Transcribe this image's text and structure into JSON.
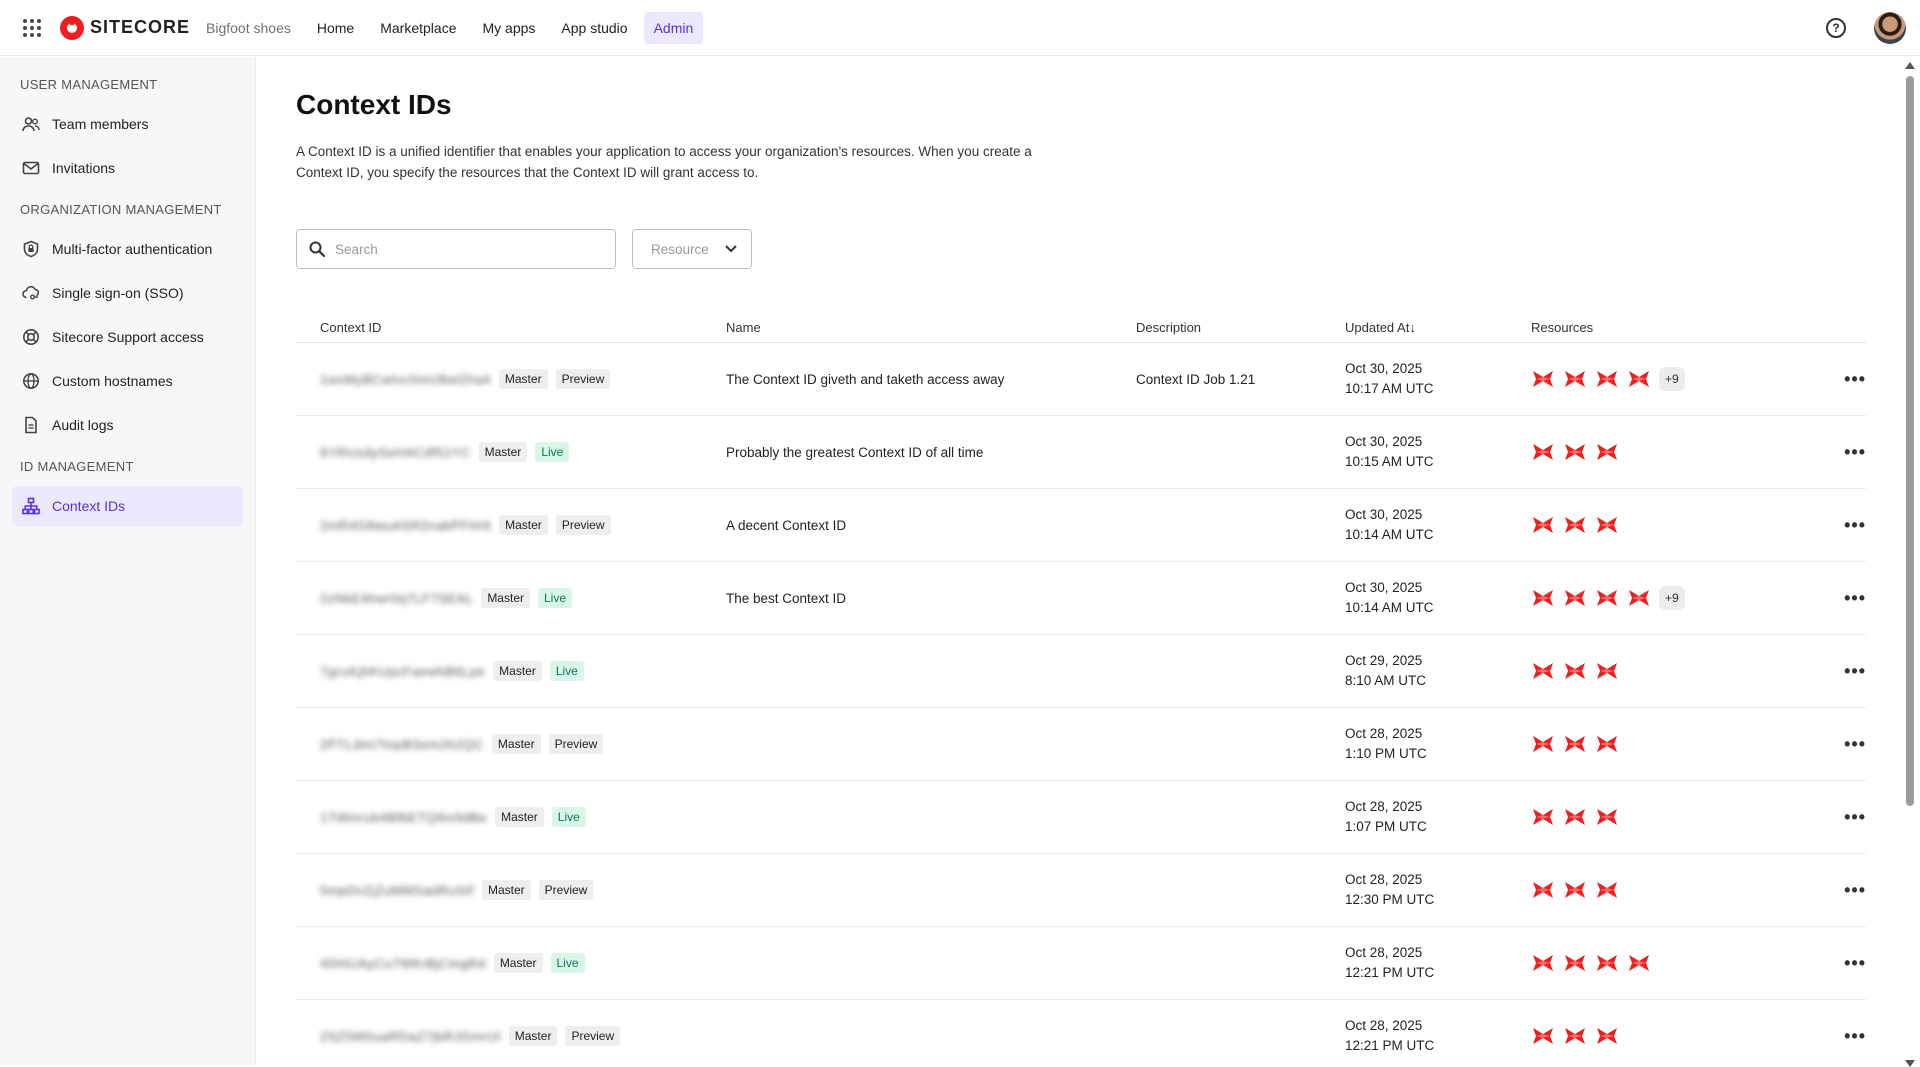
{
  "topbar": {
    "brand": "SITECORE",
    "org": "Bigfoot shoes",
    "nav": [
      {
        "label": "Home",
        "active": false
      },
      {
        "label": "Marketplace",
        "active": false
      },
      {
        "label": "My apps",
        "active": false
      },
      {
        "label": "App studio",
        "active": false
      },
      {
        "label": "Admin",
        "active": true
      }
    ],
    "help_glyph": "?"
  },
  "sidebar": {
    "sections": [
      {
        "title": "USER MANAGEMENT",
        "items": [
          {
            "label": "Team members",
            "icon": "team-icon"
          },
          {
            "label": "Invitations",
            "icon": "mail-icon"
          }
        ]
      },
      {
        "title": "ORGANIZATION MANAGEMENT",
        "items": [
          {
            "label": "Multi-factor authentication",
            "icon": "shield-lock-icon"
          },
          {
            "label": "Single sign-on (SSO)",
            "icon": "cloud-key-icon"
          },
          {
            "label": "Sitecore Support access",
            "icon": "lifebuoy-icon"
          },
          {
            "label": "Custom hostnames",
            "icon": "globe-icon"
          },
          {
            "label": "Audit logs",
            "icon": "document-icon"
          }
        ]
      },
      {
        "title": "ID MANAGEMENT",
        "items": [
          {
            "label": "Context IDs",
            "icon": "hierarchy-icon",
            "active": true
          }
        ]
      }
    ]
  },
  "main": {
    "title": "Context IDs",
    "description": "A Context ID is a unified identifier that enables your application to access your organization's resources. When you create a Context ID, you specify the resources that the Context ID will grant access to.",
    "search_placeholder": "Search",
    "resource_filter": "Resource",
    "columns": {
      "id": "Context ID",
      "name": "Name",
      "description": "Description",
      "updated": "Updated At",
      "sort_glyph": "↓",
      "resources": "Resources"
    },
    "rows": [
      {
        "id": "1wxMyBCwIvc5mU8wl2ha4",
        "env": "Master",
        "mode": "Preview",
        "name": "The Context ID giveth and taketh access away",
        "description": "Context ID Job 1.21",
        "date": "Oct 30, 2025",
        "time": "10:17 AM UTC",
        "resources": 4,
        "more": "+9"
      },
      {
        "id": "6YRUsdySeHACdf51YC",
        "env": "Master",
        "mode": "Live",
        "name": "Probably the greatest Context ID of all time",
        "description": "",
        "date": "Oct 30, 2025",
        "time": "10:15 AM UTC",
        "resources": 3,
        "more": ""
      },
      {
        "id": "2mR4G8wuASR2nakPFHr6",
        "env": "Master",
        "mode": "Preview",
        "name": "A decent Context ID",
        "description": "",
        "date": "Oct 30, 2025",
        "time": "10:14 AM UTC",
        "resources": 3,
        "more": ""
      },
      {
        "id": "2zNkE4hwr0q7LF7SEAL",
        "env": "Master",
        "mode": "Live",
        "name": "The best Context ID",
        "description": "",
        "date": "Oct 30, 2025",
        "time": "10:14 AM UTC",
        "resources": 4,
        "more": "+9"
      },
      {
        "id": "7gcxKjhKUpcFaewhB6Lpe",
        "env": "Master",
        "mode": "Live",
        "name": "",
        "description": "",
        "date": "Oct 29, 2025",
        "time": "8:10 AM UTC",
        "resources": 3,
        "more": ""
      },
      {
        "id": "2PTLdmi7tnpBSem2h2QC",
        "env": "Master",
        "mode": "Preview",
        "name": "",
        "description": "",
        "date": "Oct 28, 2025",
        "time": "1:10 PM UTC",
        "resources": 3,
        "more": ""
      },
      {
        "id": "1Tt8mrub4BfbETQ6iv9dBe",
        "env": "Master",
        "mode": "Live",
        "name": "",
        "description": "",
        "date": "Oct 28, 2025",
        "time": "1:07 PM UTC",
        "resources": 3,
        "more": ""
      },
      {
        "id": "5mpDvZjZuMMSadRuSIf",
        "env": "Master",
        "mode": "Preview",
        "name": "",
        "description": "",
        "date": "Oct 28, 2025",
        "time": "12:30 PM UTC",
        "resources": 3,
        "more": ""
      },
      {
        "id": "40HiUAyCu7WKrBjCmgRd",
        "env": "Master",
        "mode": "Live",
        "name": "",
        "description": "",
        "date": "Oct 28, 2025",
        "time": "12:21 PM UTC",
        "resources": 4,
        "more": ""
      },
      {
        "id": "2SZ5MSuaRDaZ7jbRJGmrUl",
        "env": "Master",
        "mode": "Preview",
        "name": "",
        "description": "",
        "date": "Oct 28, 2025",
        "time": "12:21 PM UTC",
        "resources": 3,
        "more": ""
      }
    ]
  },
  "colors": {
    "accent": "#5a32d6",
    "accent_bg": "#ece8ff",
    "brand_red": "#eb1f1f",
    "live_bg": "#d9f7e8",
    "live_text": "#0a7a48"
  }
}
